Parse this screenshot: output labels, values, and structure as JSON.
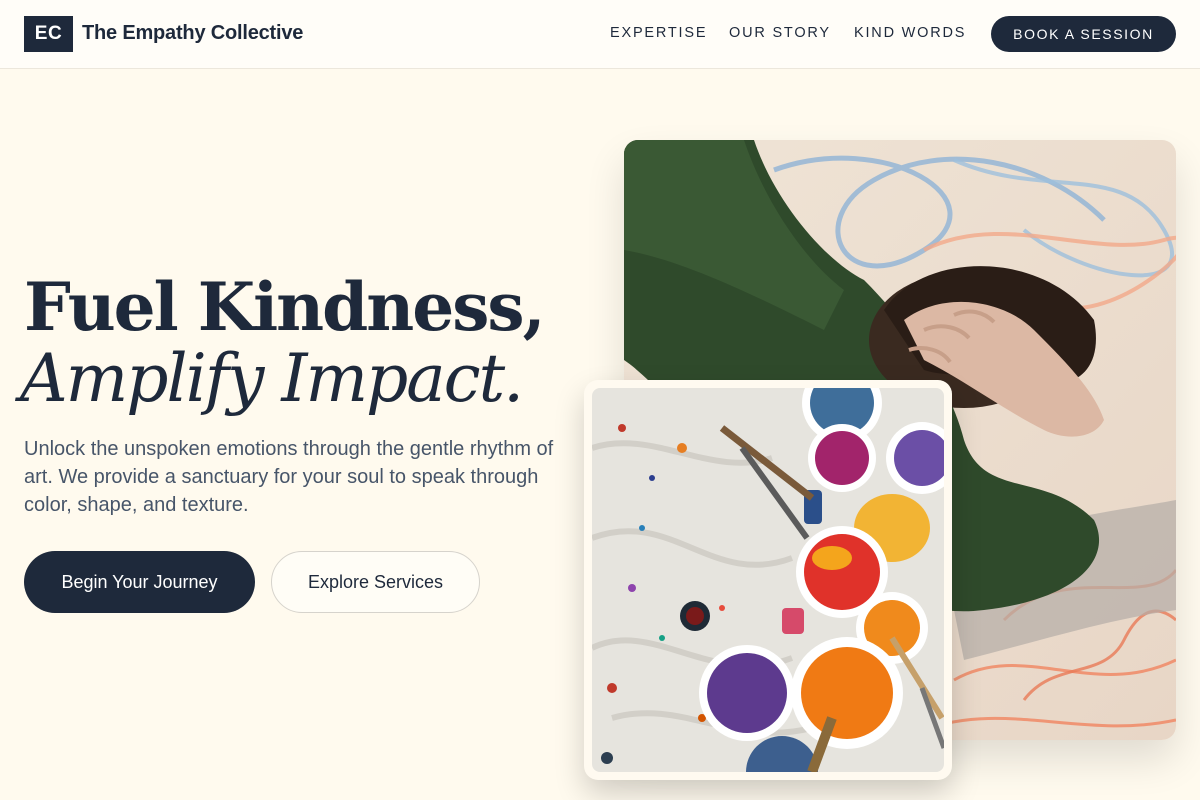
{
  "header": {
    "logo_initials": "EC",
    "brand_name": "The Empathy Collective",
    "nav": [
      "EXPERTISE",
      "OUR STORY",
      "KIND WORDS"
    ],
    "cta_label": "BOOK A SESSION"
  },
  "hero": {
    "headline_line1": "Fuel Kindness,",
    "headline_line2": "Amplify Impact.",
    "description": "Unlock the unspoken emotions through the gentle rhythm of art. We provide a sanctuary for your soul to speak through color, shape, and texture.",
    "primary_button": "Begin Your Journey",
    "secondary_button": "Explore Services"
  },
  "images": {
    "back": "person-resting-head-on-drawing-photo",
    "front": "paint-cans-on-drop-cloth-photo"
  },
  "colors": {
    "background": "#fffaee",
    "primary": "#1e293b",
    "text_muted": "#475569"
  }
}
